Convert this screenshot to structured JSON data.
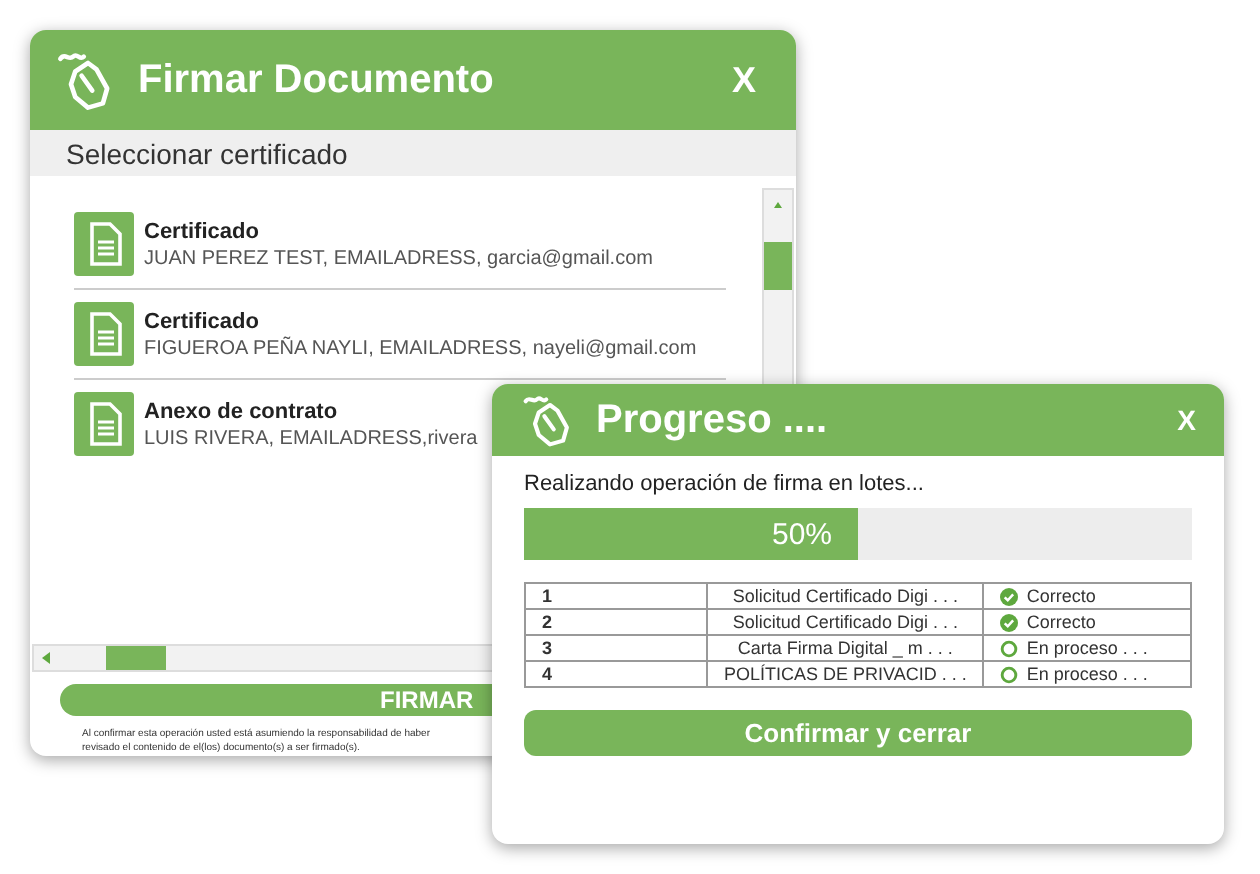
{
  "sign_window": {
    "title": "Firmar Documento",
    "close": "X",
    "subtitle": "Seleccionar certificado",
    "certificates": [
      {
        "type": "Certificado",
        "details": "JUAN PEREZ TEST, EMAILADRESS, garcia@gmail.com"
      },
      {
        "type": "Certificado",
        "details": "FIGUEROA PEÑA NAYLI, EMAILADRESS, nayeli@gmail.com"
      },
      {
        "type": "Anexo de contrato",
        "details": "LUIS RIVERA,  EMAILADRESS,rivera"
      }
    ],
    "sign_button": "FIRMAR",
    "disclaimer": "Al confirmar esta operación usted está asumiendo la responsabilidad de haber revisado el contenido de el(los) documento(s) a ser firmado(s)."
  },
  "progress_window": {
    "title": "Progreso ....",
    "close": "X",
    "message": "Realizando operación de firma en lotes...",
    "level": 0.5,
    "reading": "50%",
    "rows": [
      {
        "number": "1",
        "document": "Solicitud  Certificado Digi . . .",
        "status": "Correcto",
        "kind": "done"
      },
      {
        "number": "2",
        "document": "Solicitud  Certificado Digi . . .",
        "status": "Correcto",
        "kind": "done"
      },
      {
        "number": "3",
        "document": "Carta Firma Digital _ m . . .",
        "status": "En proceso . . .",
        "kind": "pending"
      },
      {
        "number": "4",
        "document": "POLÍTICAS DE PRIVACID . . .",
        "status": "En proceso . . .",
        "kind": "pending"
      }
    ],
    "confirm_button": "Confirmar y cerrar"
  }
}
